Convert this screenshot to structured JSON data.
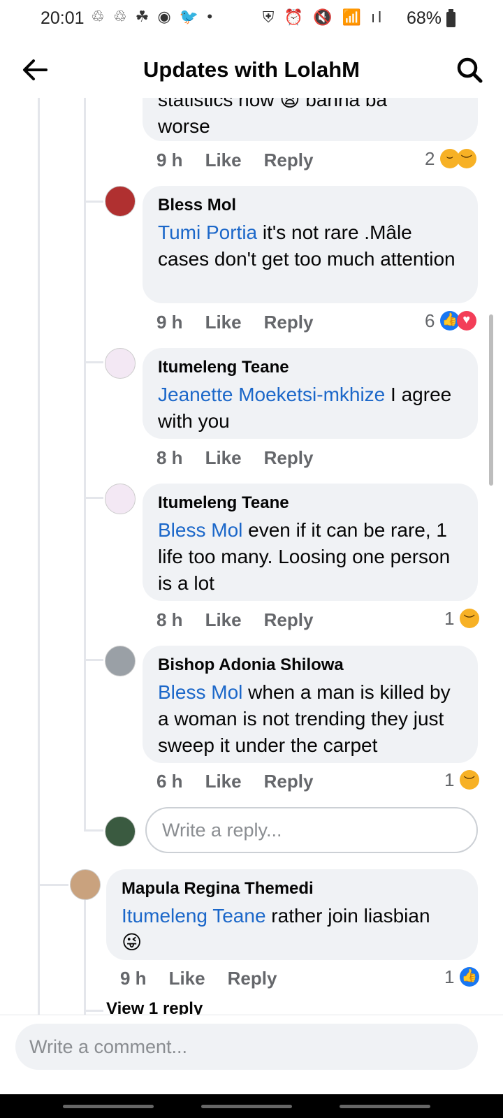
{
  "status_bar": {
    "time": "20:01",
    "notif_icons": "♲ ♲ ☘ ◉ 🐦 •",
    "right_icons": "⛨ ⏰ 🔇 📶 ıl",
    "battery": "68%"
  },
  "header": {
    "title": "Updates with LolahM"
  },
  "top_comment": {
    "partial_text": "statistics now 😩 banna ba",
    "text_end": "worse",
    "time": "9 h",
    "like": "Like",
    "reply": "Reply",
    "reaction_count": "2",
    "reaction_icons": [
      "laugh-emoji",
      "sad-emoji"
    ]
  },
  "replies": [
    {
      "author": "Bless Mol",
      "mention": "Tumi Portia",
      "text": " it's not rare .Mâle cases don't get too much attention",
      "time": "9 h",
      "like": "Like",
      "reply": "Reply",
      "reaction_count": "6",
      "reaction_icons": [
        "like-emoji",
        "love-emoji"
      ]
    },
    {
      "author": "Itumeleng Teane",
      "mention": "Jeanette Moeketsi-mkhize",
      "text": " I agree with you",
      "time": "8 h",
      "like": "Like",
      "reply": "Reply",
      "reaction_count": "",
      "reaction_icons": []
    },
    {
      "author": "Itumeleng Teane",
      "mention": "Bless Mol",
      "text": " even if it can be rare, 1 life too many. Loosing one person is a lot",
      "time": "8 h",
      "like": "Like",
      "reply": "Reply",
      "reaction_count": "1",
      "reaction_icons": [
        "sad-emoji"
      ]
    },
    {
      "author": "Bishop Adonia Shilowa",
      "mention": "Bless Mol",
      "text": " when a man is killed by a woman is not trending they just sweep it under the carpet",
      "time": "6 h",
      "like": "Like",
      "reply": "Reply",
      "reaction_count": "1",
      "reaction_icons": [
        "sad-emoji"
      ]
    }
  ],
  "reply_box": {
    "placeholder": "Write a reply..."
  },
  "next_comment": {
    "author": "Mapula Regina Themedi",
    "mention": "Itumeleng Teane",
    "text": " rather join liasbian",
    "emoji": "😜",
    "time": "9 h",
    "like": "Like",
    "reply": "Reply",
    "reaction_count": "1",
    "reaction_icons": [
      "like-emoji"
    ]
  },
  "view_replies": "View 1 reply",
  "comment_bar": {
    "placeholder": "Write a comment..."
  },
  "colors": {
    "mention": "#1b67c9",
    "bubble": "#f0f2f5",
    "meta": "#65676b"
  }
}
